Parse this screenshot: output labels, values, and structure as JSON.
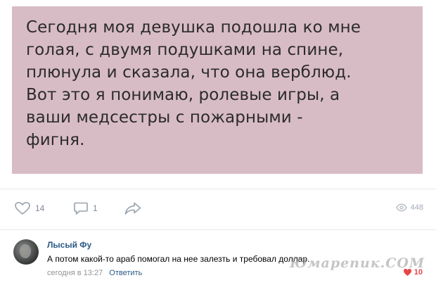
{
  "post": {
    "lines": [
      "Сегодня моя девушка подошла ко мне",
      "голая, с двумя подушками на спине,",
      "плюнула и сказала, что она верблюд.",
      "Вот это я понимаю, ролевые игры, а",
      "ваши медсестры с пожарными -",
      "фигня."
    ],
    "background": "#d8bcc5"
  },
  "actions": {
    "likes": "14",
    "comments": "1",
    "views": "448",
    "icons": {
      "like": "heart-icon",
      "comment": "comment-icon",
      "share": "share-icon",
      "views": "eye-icon"
    }
  },
  "comment": {
    "author": "Лысый Фу",
    "text": "А потом какой-то араб помогал на нее залезть и требовал доллар.",
    "time": "сегодня в 13:27",
    "reply_label": "Ответить",
    "likes": "10",
    "like_color": "#e64646"
  },
  "watermark": "Юмарепик.COM",
  "colors": {
    "link": "#2a5885",
    "muted": "#828a99"
  }
}
